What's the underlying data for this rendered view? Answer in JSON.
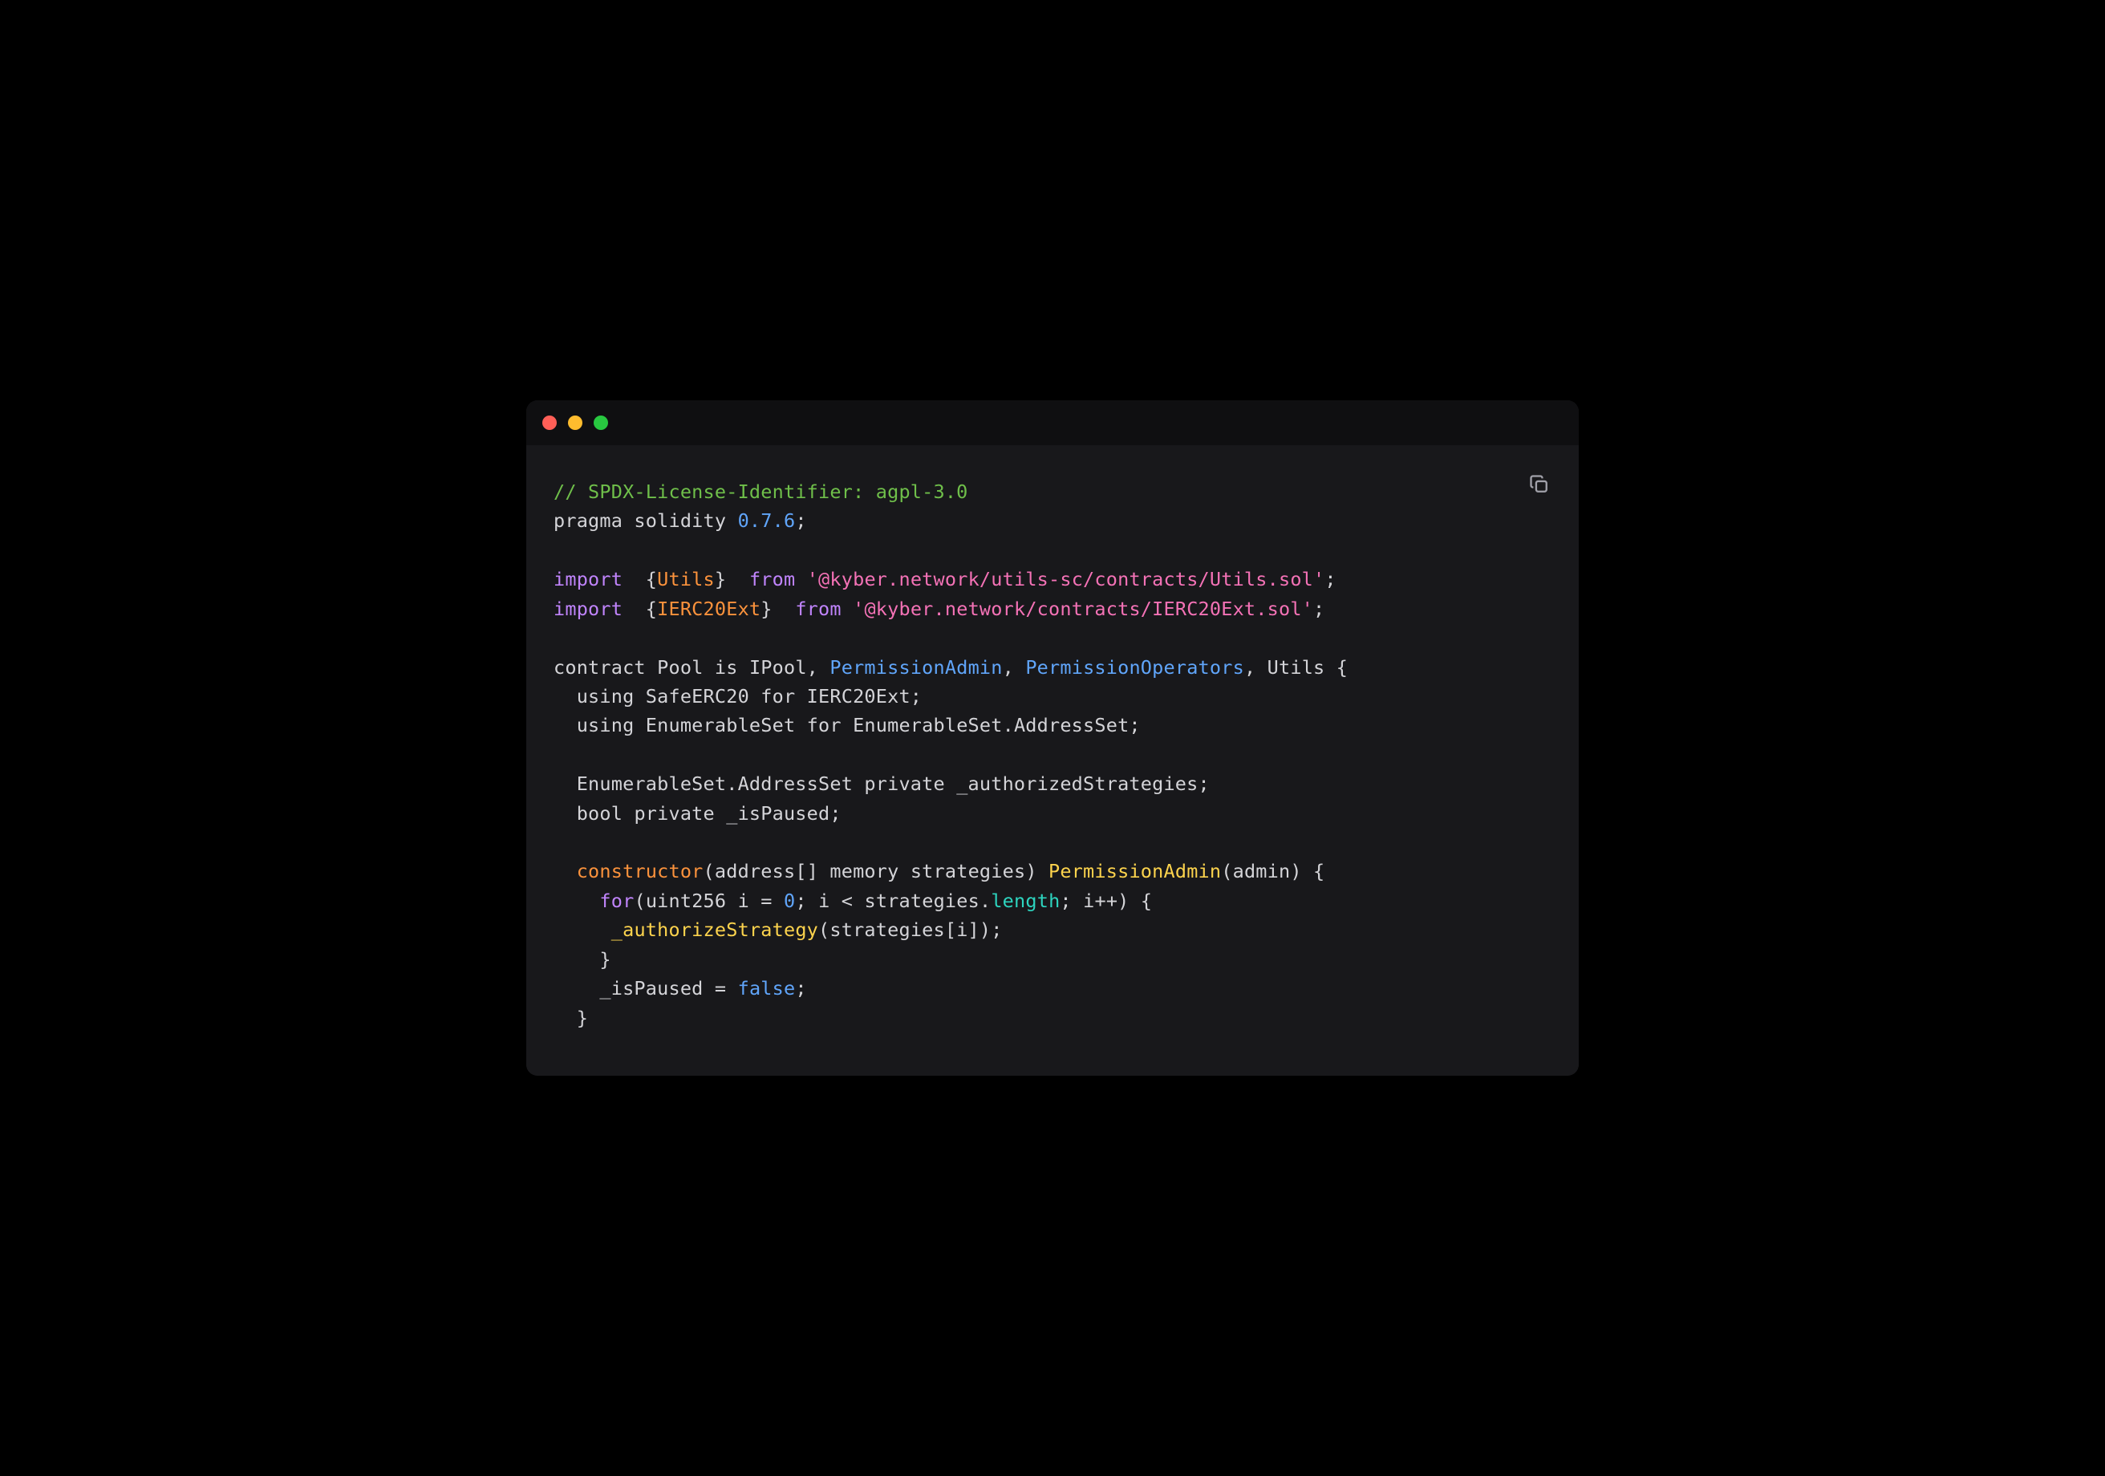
{
  "window": {
    "traffic_lights": [
      "close",
      "minimize",
      "zoom"
    ]
  },
  "copy_button": {
    "label": "Copy code",
    "icon": "copy-icon"
  },
  "code": {
    "lines": [
      {
        "segments": [
          {
            "text": "// SPDX-License-Identifier: agpl-3.0",
            "cls": "c-comment"
          }
        ]
      },
      {
        "segments": [
          {
            "text": "pragma solidity ",
            "cls": "c-default"
          },
          {
            "text": "0.7.6",
            "cls": "c-blue"
          },
          {
            "text": ";",
            "cls": "c-default"
          }
        ]
      },
      {
        "segments": [
          {
            "text": "",
            "cls": "c-default"
          }
        ]
      },
      {
        "segments": [
          {
            "text": "import",
            "cls": "c-purple"
          },
          {
            "text": "  {",
            "cls": "c-default"
          },
          {
            "text": "Utils",
            "cls": "c-orange"
          },
          {
            "text": "}  ",
            "cls": "c-default"
          },
          {
            "text": "from",
            "cls": "c-purple"
          },
          {
            "text": " ",
            "cls": "c-default"
          },
          {
            "text": "'@kyber.network/utils-sc/contracts/Utils.sol'",
            "cls": "c-pink"
          },
          {
            "text": ";",
            "cls": "c-default"
          }
        ]
      },
      {
        "segments": [
          {
            "text": "import",
            "cls": "c-purple"
          },
          {
            "text": "  {",
            "cls": "c-default"
          },
          {
            "text": "IERC20Ext",
            "cls": "c-orange"
          },
          {
            "text": "}  ",
            "cls": "c-default"
          },
          {
            "text": "from",
            "cls": "c-purple"
          },
          {
            "text": " ",
            "cls": "c-default"
          },
          {
            "text": "'@kyber.network/contracts/IERC20Ext.sol'",
            "cls": "c-pink"
          },
          {
            "text": ";",
            "cls": "c-default"
          }
        ]
      },
      {
        "segments": [
          {
            "text": "",
            "cls": "c-default"
          }
        ]
      },
      {
        "segments": [
          {
            "text": "contract",
            "cls": "c-default"
          },
          {
            "text": " Pool ",
            "cls": "c-default"
          },
          {
            "text": "is",
            "cls": "c-default"
          },
          {
            "text": " IPool, ",
            "cls": "c-default"
          },
          {
            "text": "PermissionAdmin",
            "cls": "c-blue"
          },
          {
            "text": ", ",
            "cls": "c-default"
          },
          {
            "text": "PermissionOperators",
            "cls": "c-blue"
          },
          {
            "text": ", Utils {",
            "cls": "c-default"
          }
        ]
      },
      {
        "segments": [
          {
            "text": "  using SafeERC20 ",
            "cls": "c-default"
          },
          {
            "text": "for",
            "cls": "c-default"
          },
          {
            "text": " IERC20Ext;",
            "cls": "c-default"
          }
        ]
      },
      {
        "segments": [
          {
            "text": "  using EnumerableSet ",
            "cls": "c-default"
          },
          {
            "text": "for",
            "cls": "c-default"
          },
          {
            "text": " EnumerableSet.AddressSet;",
            "cls": "c-default"
          }
        ]
      },
      {
        "segments": [
          {
            "text": "",
            "cls": "c-default"
          }
        ]
      },
      {
        "segments": [
          {
            "text": "  EnumerableSet.AddressSet ",
            "cls": "c-default"
          },
          {
            "text": "private",
            "cls": "c-default"
          },
          {
            "text": " _authorizedStrategies;",
            "cls": "c-default"
          }
        ]
      },
      {
        "segments": [
          {
            "text": "  bool ",
            "cls": "c-default"
          },
          {
            "text": "private",
            "cls": "c-default"
          },
          {
            "text": " _isPaused;",
            "cls": "c-default"
          }
        ]
      },
      {
        "segments": [
          {
            "text": "",
            "cls": "c-default"
          }
        ]
      },
      {
        "segments": [
          {
            "text": "  ",
            "cls": "c-default"
          },
          {
            "text": "constructor",
            "cls": "c-orange"
          },
          {
            "text": "(",
            "cls": "c-default"
          },
          {
            "text": "address",
            "cls": "c-default"
          },
          {
            "text": "[] ",
            "cls": "c-default"
          },
          {
            "text": "memory",
            "cls": "c-default"
          },
          {
            "text": " strategies) ",
            "cls": "c-default"
          },
          {
            "text": "PermissionAdmin",
            "cls": "c-func"
          },
          {
            "text": "(admin) {",
            "cls": "c-default"
          }
        ]
      },
      {
        "segments": [
          {
            "text": "    ",
            "cls": "c-default"
          },
          {
            "text": "for",
            "cls": "c-purple"
          },
          {
            "text": "(",
            "cls": "c-default"
          },
          {
            "text": "uint256",
            "cls": "c-default"
          },
          {
            "text": " i ",
            "cls": "c-default"
          },
          {
            "text": "=",
            "cls": "c-op"
          },
          {
            "text": " ",
            "cls": "c-default"
          },
          {
            "text": "0",
            "cls": "c-blue"
          },
          {
            "text": "; i ",
            "cls": "c-default"
          },
          {
            "text": "<",
            "cls": "c-op"
          },
          {
            "text": " strategies.",
            "cls": "c-default"
          },
          {
            "text": "length",
            "cls": "c-teal"
          },
          {
            "text": "; i",
            "cls": "c-default"
          },
          {
            "text": "++",
            "cls": "c-op"
          },
          {
            "text": ") {",
            "cls": "c-default"
          }
        ]
      },
      {
        "segments": [
          {
            "text": "     ",
            "cls": "c-default"
          },
          {
            "text": "_authorizeStrategy",
            "cls": "c-func"
          },
          {
            "text": "(strategies[i]);",
            "cls": "c-default"
          }
        ]
      },
      {
        "segments": [
          {
            "text": "    }",
            "cls": "c-default"
          }
        ]
      },
      {
        "segments": [
          {
            "text": "    _isPaused ",
            "cls": "c-default"
          },
          {
            "text": "=",
            "cls": "c-op"
          },
          {
            "text": " ",
            "cls": "c-default"
          },
          {
            "text": "false",
            "cls": "c-blue"
          },
          {
            "text": ";",
            "cls": "c-default"
          }
        ]
      },
      {
        "segments": [
          {
            "text": "  }",
            "cls": "c-default"
          }
        ]
      }
    ]
  }
}
